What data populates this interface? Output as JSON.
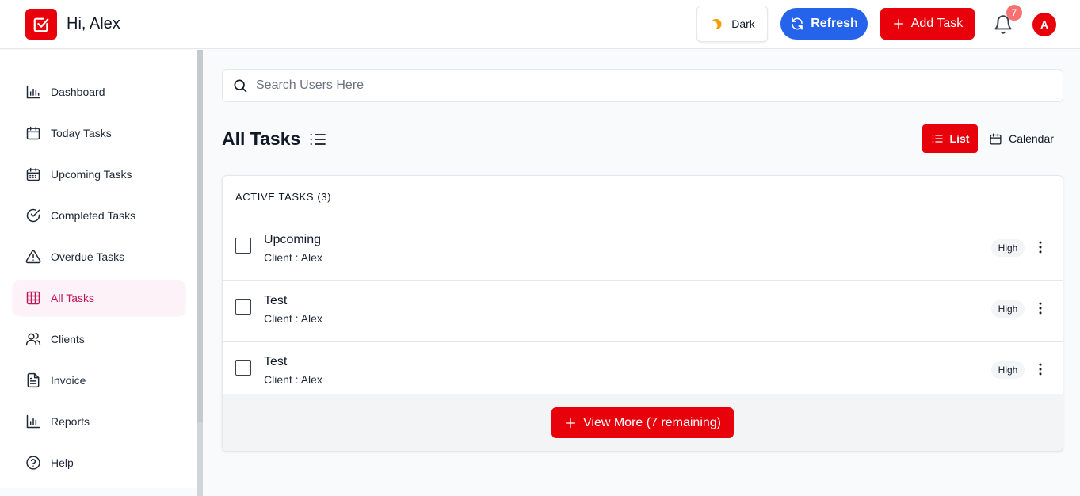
{
  "header": {
    "greeting": "Hi, Alex",
    "theme_label": "Dark",
    "refresh_label": "Refresh",
    "add_task_label": "Add Task",
    "notification_count": "7",
    "avatar_initial": "A"
  },
  "sidebar": {
    "items": [
      {
        "label": "Dashboard",
        "icon": "bar-chart-icon"
      },
      {
        "label": "Today Tasks",
        "icon": "calendar-icon"
      },
      {
        "label": "Upcoming Tasks",
        "icon": "calendar-days-icon"
      },
      {
        "label": "Completed Tasks",
        "icon": "check-circle-icon"
      },
      {
        "label": "Overdue Tasks",
        "icon": "warning-icon"
      },
      {
        "label": "All Tasks",
        "icon": "grid-icon",
        "active": true
      },
      {
        "label": "Clients",
        "icon": "users-icon"
      },
      {
        "label": "Invoice",
        "icon": "document-icon"
      },
      {
        "label": "Reports",
        "icon": "bar-chart-icon"
      },
      {
        "label": "Help",
        "icon": "help-circle-icon"
      }
    ]
  },
  "search": {
    "placeholder": "Search Users Here"
  },
  "main": {
    "title": "All Tasks",
    "view_list_label": "List",
    "view_calendar_label": "Calendar",
    "section_label": "ACTIVE TASKS (3)",
    "tasks": [
      {
        "title": "Upcoming",
        "client": "Client : Alex",
        "priority": "High"
      },
      {
        "title": "Test",
        "client": "Client : Alex",
        "priority": "High"
      },
      {
        "title": "Test",
        "client": "Client : Alex",
        "priority": "High"
      }
    ],
    "view_more_label": "View More (7 remaining)"
  },
  "colors": {
    "brand_red": "#e8000b",
    "refresh_blue": "#2563eb",
    "active_nav_text": "#be185d",
    "active_nav_bg": "#fdf2f8"
  }
}
